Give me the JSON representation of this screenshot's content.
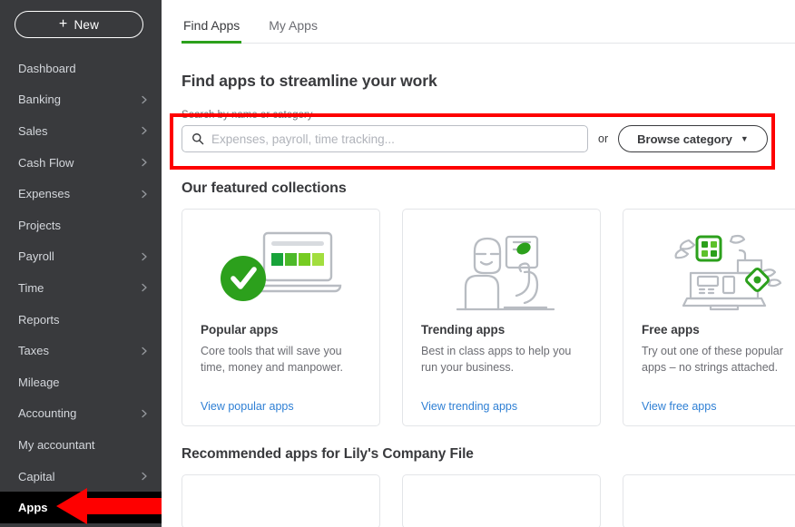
{
  "sidebar": {
    "new_button": {
      "label": "New",
      "icon": "plus-icon"
    },
    "items": [
      {
        "label": "Dashboard",
        "expandable": false,
        "active": false
      },
      {
        "label": "Banking",
        "expandable": true,
        "active": false
      },
      {
        "label": "Sales",
        "expandable": true,
        "active": false
      },
      {
        "label": "Cash Flow",
        "expandable": true,
        "active": false
      },
      {
        "label": "Expenses",
        "expandable": true,
        "active": false
      },
      {
        "label": "Projects",
        "expandable": false,
        "active": false
      },
      {
        "label": "Payroll",
        "expandable": true,
        "active": false
      },
      {
        "label": "Time",
        "expandable": true,
        "active": false
      },
      {
        "label": "Reports",
        "expandable": false,
        "active": false
      },
      {
        "label": "Taxes",
        "expandable": true,
        "active": false
      },
      {
        "label": "Mileage",
        "expandable": false,
        "active": false
      },
      {
        "label": "Accounting",
        "expandable": true,
        "active": false
      },
      {
        "label": "My accountant",
        "expandable": false,
        "active": false
      },
      {
        "label": "Capital",
        "expandable": true,
        "active": false
      },
      {
        "label": "Apps",
        "expandable": false,
        "active": true
      }
    ]
  },
  "tabs": [
    {
      "label": "Find Apps",
      "active": true
    },
    {
      "label": "My Apps",
      "active": false
    }
  ],
  "main": {
    "page_title": "Find apps to streamline your work",
    "search": {
      "label": "Search by name or category",
      "placeholder": "Expenses, payroll, time tracking...",
      "value": "",
      "or_text": "or",
      "browse_button": "Browse category",
      "browse_caret": "▼"
    },
    "featured_heading": "Our featured collections",
    "cards": [
      {
        "title": "Popular apps",
        "desc": "Core tools that will save you time, money and manpower.",
        "link": "View popular apps",
        "art": "laptop-check-icon"
      },
      {
        "title": "Trending apps",
        "desc": "Best in class apps to help you run your business.",
        "link": "View trending apps",
        "art": "person-chart-icon"
      },
      {
        "title": "Free apps",
        "desc": "Try out one of these popular apps – no strings attached.",
        "link": "View free apps",
        "art": "register-gifts-icon"
      }
    ],
    "recommended_heading": "Recommended apps for Lily's Company File"
  },
  "annotations": {
    "highlight_color": "#fe0000",
    "search_highlight": true,
    "apps_arrow": true
  },
  "colors": {
    "sidebar_bg": "#393a3d",
    "active_nav_bg": "#000000",
    "accent_green": "#2ca01c",
    "link_blue": "#2e7fd4",
    "annotation_red": "#fe0000"
  }
}
